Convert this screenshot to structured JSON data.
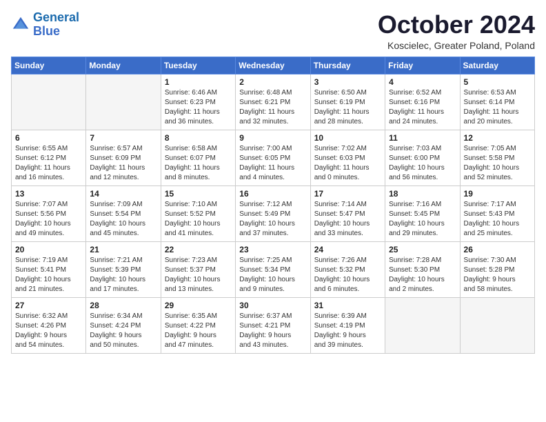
{
  "header": {
    "logo_line1": "General",
    "logo_line2": "Blue",
    "month_title": "October 2024",
    "location": "Koscielec, Greater Poland, Poland"
  },
  "weekdays": [
    "Sunday",
    "Monday",
    "Tuesday",
    "Wednesday",
    "Thursday",
    "Friday",
    "Saturday"
  ],
  "weeks": [
    [
      {
        "day": "",
        "info": ""
      },
      {
        "day": "",
        "info": ""
      },
      {
        "day": "1",
        "info": "Sunrise: 6:46 AM\nSunset: 6:23 PM\nDaylight: 11 hours\nand 36 minutes."
      },
      {
        "day": "2",
        "info": "Sunrise: 6:48 AM\nSunset: 6:21 PM\nDaylight: 11 hours\nand 32 minutes."
      },
      {
        "day": "3",
        "info": "Sunrise: 6:50 AM\nSunset: 6:19 PM\nDaylight: 11 hours\nand 28 minutes."
      },
      {
        "day": "4",
        "info": "Sunrise: 6:52 AM\nSunset: 6:16 PM\nDaylight: 11 hours\nand 24 minutes."
      },
      {
        "day": "5",
        "info": "Sunrise: 6:53 AM\nSunset: 6:14 PM\nDaylight: 11 hours\nand 20 minutes."
      }
    ],
    [
      {
        "day": "6",
        "info": "Sunrise: 6:55 AM\nSunset: 6:12 PM\nDaylight: 11 hours\nand 16 minutes."
      },
      {
        "day": "7",
        "info": "Sunrise: 6:57 AM\nSunset: 6:09 PM\nDaylight: 11 hours\nand 12 minutes."
      },
      {
        "day": "8",
        "info": "Sunrise: 6:58 AM\nSunset: 6:07 PM\nDaylight: 11 hours\nand 8 minutes."
      },
      {
        "day": "9",
        "info": "Sunrise: 7:00 AM\nSunset: 6:05 PM\nDaylight: 11 hours\nand 4 minutes."
      },
      {
        "day": "10",
        "info": "Sunrise: 7:02 AM\nSunset: 6:03 PM\nDaylight: 11 hours\nand 0 minutes."
      },
      {
        "day": "11",
        "info": "Sunrise: 7:03 AM\nSunset: 6:00 PM\nDaylight: 10 hours\nand 56 minutes."
      },
      {
        "day": "12",
        "info": "Sunrise: 7:05 AM\nSunset: 5:58 PM\nDaylight: 10 hours\nand 52 minutes."
      }
    ],
    [
      {
        "day": "13",
        "info": "Sunrise: 7:07 AM\nSunset: 5:56 PM\nDaylight: 10 hours\nand 49 minutes."
      },
      {
        "day": "14",
        "info": "Sunrise: 7:09 AM\nSunset: 5:54 PM\nDaylight: 10 hours\nand 45 minutes."
      },
      {
        "day": "15",
        "info": "Sunrise: 7:10 AM\nSunset: 5:52 PM\nDaylight: 10 hours\nand 41 minutes."
      },
      {
        "day": "16",
        "info": "Sunrise: 7:12 AM\nSunset: 5:49 PM\nDaylight: 10 hours\nand 37 minutes."
      },
      {
        "day": "17",
        "info": "Sunrise: 7:14 AM\nSunset: 5:47 PM\nDaylight: 10 hours\nand 33 minutes."
      },
      {
        "day": "18",
        "info": "Sunrise: 7:16 AM\nSunset: 5:45 PM\nDaylight: 10 hours\nand 29 minutes."
      },
      {
        "day": "19",
        "info": "Sunrise: 7:17 AM\nSunset: 5:43 PM\nDaylight: 10 hours\nand 25 minutes."
      }
    ],
    [
      {
        "day": "20",
        "info": "Sunrise: 7:19 AM\nSunset: 5:41 PM\nDaylight: 10 hours\nand 21 minutes."
      },
      {
        "day": "21",
        "info": "Sunrise: 7:21 AM\nSunset: 5:39 PM\nDaylight: 10 hours\nand 17 minutes."
      },
      {
        "day": "22",
        "info": "Sunrise: 7:23 AM\nSunset: 5:37 PM\nDaylight: 10 hours\nand 13 minutes."
      },
      {
        "day": "23",
        "info": "Sunrise: 7:25 AM\nSunset: 5:34 PM\nDaylight: 10 hours\nand 9 minutes."
      },
      {
        "day": "24",
        "info": "Sunrise: 7:26 AM\nSunset: 5:32 PM\nDaylight: 10 hours\nand 6 minutes."
      },
      {
        "day": "25",
        "info": "Sunrise: 7:28 AM\nSunset: 5:30 PM\nDaylight: 10 hours\nand 2 minutes."
      },
      {
        "day": "26",
        "info": "Sunrise: 7:30 AM\nSunset: 5:28 PM\nDaylight: 9 hours\nand 58 minutes."
      }
    ],
    [
      {
        "day": "27",
        "info": "Sunrise: 6:32 AM\nSunset: 4:26 PM\nDaylight: 9 hours\nand 54 minutes."
      },
      {
        "day": "28",
        "info": "Sunrise: 6:34 AM\nSunset: 4:24 PM\nDaylight: 9 hours\nand 50 minutes."
      },
      {
        "day": "29",
        "info": "Sunrise: 6:35 AM\nSunset: 4:22 PM\nDaylight: 9 hours\nand 47 minutes."
      },
      {
        "day": "30",
        "info": "Sunrise: 6:37 AM\nSunset: 4:21 PM\nDaylight: 9 hours\nand 43 minutes."
      },
      {
        "day": "31",
        "info": "Sunrise: 6:39 AM\nSunset: 4:19 PM\nDaylight: 9 hours\nand 39 minutes."
      },
      {
        "day": "",
        "info": ""
      },
      {
        "day": "",
        "info": ""
      }
    ]
  ]
}
